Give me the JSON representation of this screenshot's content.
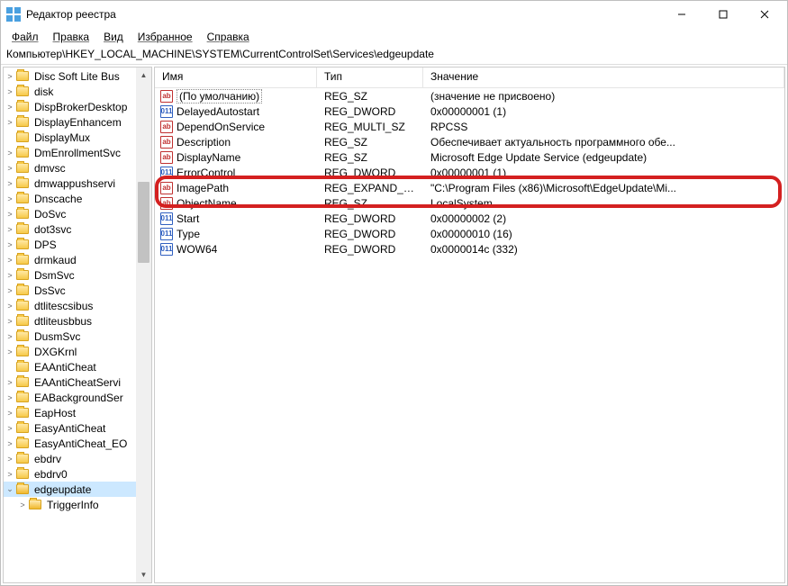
{
  "window": {
    "title": "Редактор реестра"
  },
  "menu": {
    "file": "Файл",
    "edit": "Правка",
    "view": "Вид",
    "favorites": "Избранное",
    "help": "Справка"
  },
  "address": "Компьютер\\HKEY_LOCAL_MACHINE\\SYSTEM\\CurrentControlSet\\Services\\edgeupdate",
  "tree": [
    {
      "label": "Disc Soft Lite Bus",
      "expander": ">"
    },
    {
      "label": "disk",
      "expander": ">"
    },
    {
      "label": "DispBrokerDesktop",
      "expander": ">"
    },
    {
      "label": "DisplayEnhancem",
      "expander": ">"
    },
    {
      "label": "DisplayMux",
      "expander": ""
    },
    {
      "label": "DmEnrollmentSvc",
      "expander": ">"
    },
    {
      "label": "dmvsc",
      "expander": ">"
    },
    {
      "label": "dmwappushservi",
      "expander": ">"
    },
    {
      "label": "Dnscache",
      "expander": ">"
    },
    {
      "label": "DoSvc",
      "expander": ">"
    },
    {
      "label": "dot3svc",
      "expander": ">"
    },
    {
      "label": "DPS",
      "expander": ">"
    },
    {
      "label": "drmkaud",
      "expander": ">"
    },
    {
      "label": "DsmSvc",
      "expander": ">"
    },
    {
      "label": "DsSvc",
      "expander": ">"
    },
    {
      "label": "dtlitescsibus",
      "expander": ">"
    },
    {
      "label": "dtliteusbbus",
      "expander": ">"
    },
    {
      "label": "DusmSvc",
      "expander": ">"
    },
    {
      "label": "DXGKrnl",
      "expander": ">"
    },
    {
      "label": "EAAntiCheat",
      "expander": ""
    },
    {
      "label": "EAAntiCheatServi",
      "expander": ">"
    },
    {
      "label": "EABackgroundSer",
      "expander": ">"
    },
    {
      "label": "EapHost",
      "expander": ">"
    },
    {
      "label": "EasyAntiCheat",
      "expander": ">"
    },
    {
      "label": "EasyAntiCheat_EO",
      "expander": ">"
    },
    {
      "label": "ebdrv",
      "expander": ">"
    },
    {
      "label": "ebdrv0",
      "expander": ">"
    },
    {
      "label": "edgeupdate",
      "expander": "v",
      "selected": true
    },
    {
      "label": "TriggerInfo",
      "expander": ">",
      "child": true
    }
  ],
  "columns": {
    "name": "Имя",
    "type": "Тип",
    "value": "Значение"
  },
  "rows": [
    {
      "icon": "str",
      "name": "(По умолчанию)",
      "type": "REG_SZ",
      "value": "(значение не присвоено)",
      "default": true
    },
    {
      "icon": "bin",
      "name": "DelayedAutostart",
      "type": "REG_DWORD",
      "value": "0x00000001 (1)"
    },
    {
      "icon": "str",
      "name": "DependOnService",
      "type": "REG_MULTI_SZ",
      "value": "RPCSS"
    },
    {
      "icon": "str",
      "name": "Description",
      "type": "REG_SZ",
      "value": "Обеспечивает актуальность программного обе..."
    },
    {
      "icon": "str",
      "name": "DisplayName",
      "type": "REG_SZ",
      "value": "Microsoft Edge Update Service (edgeupdate)"
    },
    {
      "icon": "bin",
      "name": "ErrorControl",
      "type": "REG_DWORD",
      "value": "0x00000001 (1)"
    },
    {
      "icon": "str",
      "name": "ImagePath",
      "type": "REG_EXPAND_SZ",
      "value": "\"C:\\Program Files (x86)\\Microsoft\\EdgeUpdate\\Mi..."
    },
    {
      "icon": "str",
      "name": "ObjectName",
      "type": "REG_SZ",
      "value": "LocalSystem"
    },
    {
      "icon": "bin",
      "name": "Start",
      "type": "REG_DWORD",
      "value": "0x00000002 (2)"
    },
    {
      "icon": "bin",
      "name": "Type",
      "type": "REG_DWORD",
      "value": "0x00000010 (16)"
    },
    {
      "icon": "bin",
      "name": "WOW64",
      "type": "REG_DWORD",
      "value": "0x0000014c (332)"
    }
  ],
  "icons": {
    "str": "ab",
    "bin": "011"
  }
}
